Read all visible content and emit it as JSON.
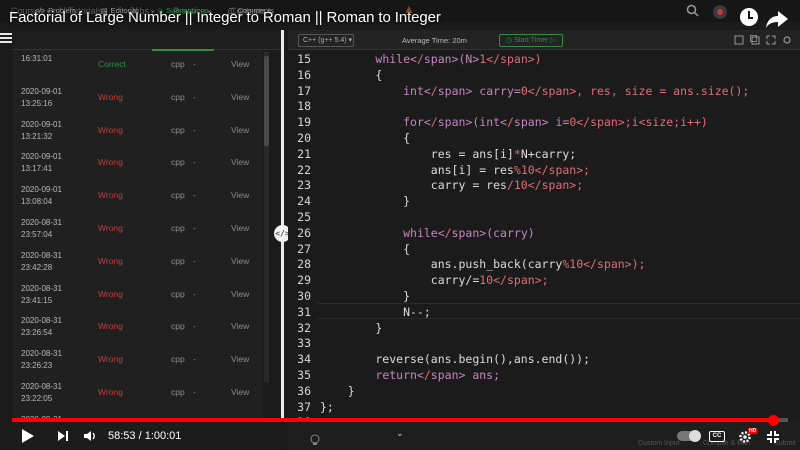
{
  "video": {
    "title": "Factorial of Large Number || Integer to Roman || Roman to Integer",
    "time_display": "58:53 / 1:00:01",
    "progress": 0.981
  },
  "site_nav": {
    "items": [
      "Courses",
      "Tutorials",
      "Jobs",
      "Practice",
      "Contests"
    ]
  },
  "tabs": [
    {
      "icon": "</>",
      "label": "Problem"
    },
    {
      "icon": "▤",
      "label": "Editorial"
    },
    {
      "icon": "◎",
      "label": "Submissions"
    },
    {
      "icon": "▢",
      "label": "Comments"
    }
  ],
  "submissions": [
    {
      "date": "",
      "time": "16:31:01",
      "status": "Correct",
      "lang": "cpp",
      "score": "-",
      "action": "View"
    },
    {
      "date": "2020-09-01",
      "time": "13:25:16",
      "status": "Wrong",
      "lang": "cpp",
      "score": "-",
      "action": "View"
    },
    {
      "date": "2020-09-01",
      "time": "13:21:32",
      "status": "Wrong",
      "lang": "cpp",
      "score": "-",
      "action": "View"
    },
    {
      "date": "2020-09-01",
      "time": "13:17:41",
      "status": "Wrong",
      "lang": "cpp",
      "score": "-",
      "action": "View"
    },
    {
      "date": "2020-09-01",
      "time": "13:08:04",
      "status": "Wrong",
      "lang": "cpp",
      "score": "-",
      "action": "View"
    },
    {
      "date": "2020-08-31",
      "time": "23:57:04",
      "status": "Wrong",
      "lang": "cpp",
      "score": "-",
      "action": "View"
    },
    {
      "date": "2020-08-31",
      "time": "23:42:28",
      "status": "Wrong",
      "lang": "cpp",
      "score": "-",
      "action": "View"
    },
    {
      "date": "2020-08-31",
      "time": "23:41:15",
      "status": "Wrong",
      "lang": "cpp",
      "score": "-",
      "action": "View"
    },
    {
      "date": "2020-08-31",
      "time": "23:26:54",
      "status": "Wrong",
      "lang": "cpp",
      "score": "-",
      "action": "View"
    },
    {
      "date": "2020-08-31",
      "time": "23:26:23",
      "status": "Wrong",
      "lang": "cpp",
      "score": "-",
      "action": "View"
    },
    {
      "date": "2020-08-31",
      "time": "23:22:05",
      "status": "Wrong",
      "lang": "cpp",
      "score": "-",
      "action": "View"
    },
    {
      "date": "2020-08-31",
      "time": "",
      "status": "Wrong",
      "lang": "cpp",
      "score": "-",
      "action": "View"
    }
  ],
  "editor": {
    "language": "C++ (g++ 5.4)",
    "average_time": "Average Time: 20m",
    "start_timer": "Start Timer",
    "lines": [
      {
        "n": "15",
        "text": "        while(N>1)"
      },
      {
        "n": "16",
        "text": "        {"
      },
      {
        "n": "17",
        "text": "            int carry=0, res, size = ans.size();"
      },
      {
        "n": "18",
        "text": ""
      },
      {
        "n": "19",
        "text": "            for(int i=0;i<size;i++)"
      },
      {
        "n": "20",
        "text": "            {"
      },
      {
        "n": "21",
        "text": "                res = ans[i]*N+carry;"
      },
      {
        "n": "22",
        "text": "                ans[i] = res%10;"
      },
      {
        "n": "23",
        "text": "                carry = res/10;"
      },
      {
        "n": "24",
        "text": "            }"
      },
      {
        "n": "25",
        "text": ""
      },
      {
        "n": "26",
        "text": "            while(carry)"
      },
      {
        "n": "27",
        "text": "            {"
      },
      {
        "n": "28",
        "text": "                ans.push_back(carry%10);"
      },
      {
        "n": "29",
        "text": "                carry/=10;"
      },
      {
        "n": "30",
        "text": "            }"
      },
      {
        "n": "31",
        "text": "            N--;"
      },
      {
        "n": "32",
        "text": "        }"
      },
      {
        "n": "33",
        "text": ""
      },
      {
        "n": "34",
        "text": "        reverse(ans.begin(),ans.end());"
      },
      {
        "n": "35",
        "text": "        return ans;"
      },
      {
        "n": "36",
        "text": "    }"
      },
      {
        "n": "37",
        "text": "};"
      },
      {
        "n": "38",
        "text": ""
      }
    ]
  },
  "footer": {
    "custom_input": "Custom Input",
    "compile_run": "Compile & Run",
    "submit": "Submit",
    "hd_badge": "HD",
    "cc_label": "CC"
  },
  "colors": {
    "accent_green": "#2f8d46",
    "wrong_red": "#c33b3b",
    "progress_red": "#ff0000",
    "keyword_purple": "#c586c0",
    "number_red": "#e06c75"
  }
}
